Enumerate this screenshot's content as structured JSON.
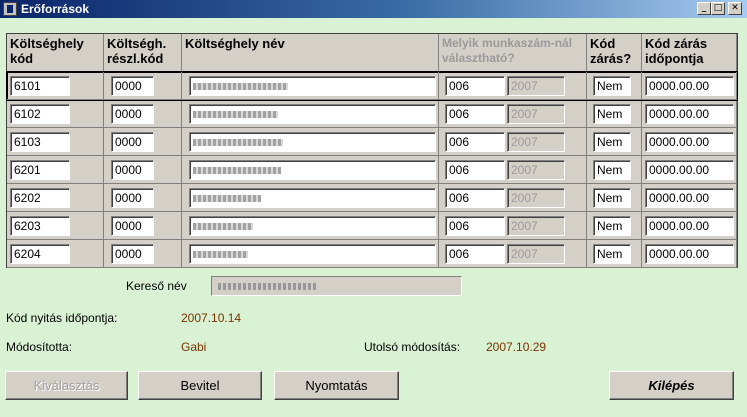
{
  "window": {
    "title": "Erőforrások",
    "controls": {
      "minimize": "_",
      "maximize": "□",
      "close": "✕"
    }
  },
  "grid": {
    "headers": {
      "kod": "Költséghely kód",
      "reszl": "Költségh. részl.kód",
      "nev": "Költséghely név",
      "munkaszam": "Melyik munkaszám-nál választható?",
      "zaras": "Kód zárás?",
      "zaras_ido": "Kód zárás időpontja"
    },
    "rows": [
      {
        "kod": "6101",
        "reszl": "0000",
        "munkaszam": "006",
        "ev": "2007",
        "zaras": "Nem",
        "zaras_ido": "0000.00.00"
      },
      {
        "kod": "6102",
        "reszl": "0000",
        "munkaszam": "006",
        "ev": "2007",
        "zaras": "Nem",
        "zaras_ido": "0000.00.00"
      },
      {
        "kod": "6103",
        "reszl": "0000",
        "munkaszam": "006",
        "ev": "2007",
        "zaras": "Nem",
        "zaras_ido": "0000.00.00"
      },
      {
        "kod": "6201",
        "reszl": "0000",
        "munkaszam": "006",
        "ev": "2007",
        "zaras": "Nem",
        "zaras_ido": "0000.00.00"
      },
      {
        "kod": "6202",
        "reszl": "0000",
        "munkaszam": "006",
        "ev": "2007",
        "zaras": "Nem",
        "zaras_ido": "0000.00.00"
      },
      {
        "kod": "6203",
        "reszl": "0000",
        "munkaszam": "006",
        "ev": "2007",
        "zaras": "Nem",
        "zaras_ido": "0000.00.00"
      },
      {
        "kod": "6204",
        "reszl": "0000",
        "munkaszam": "006",
        "ev": "2007",
        "zaras": "Nem",
        "zaras_ido": "0000.00.00"
      }
    ]
  },
  "details": {
    "kereso_label": "Kereső név",
    "nyitas_label": "Kód nyitás időpontja:",
    "nyitas_value": "2007.10.14",
    "modositotta_label": "Módosította:",
    "modositotta_value": "Gabi",
    "utolso_label": "Utolsó módosítás:",
    "utolso_value": "2007.10.29"
  },
  "buttons": {
    "kivalasztas": "Kiválasztás",
    "bevitel": "Bevitel",
    "nyomtatas": "Nyomtatás",
    "kilepes": "Kilépés"
  },
  "colors": {
    "background": "#d9f2d3",
    "value_text": "#7a3300",
    "titlebar": "#0a246a"
  }
}
